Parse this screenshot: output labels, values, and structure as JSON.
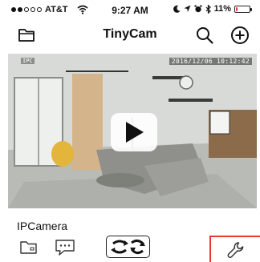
{
  "status_bar": {
    "signal_dots_filled": 2,
    "signal_dots_total": 5,
    "carrier": "AT&T",
    "time": "9:27 AM",
    "battery_percent": "11%",
    "battery_level": 0.11,
    "icons": [
      "wifi-icon",
      "moon-icon",
      "location-icon",
      "alarm-icon",
      "bluetooth-icon"
    ]
  },
  "nav": {
    "title": "TinyCam",
    "left_icon": "folder-icon",
    "right_icons": [
      "search-icon",
      "add-icon"
    ]
  },
  "camera": {
    "name": "IPCamera",
    "overlay_label": "IPC",
    "timestamp": "2016/12/06 10:12:42",
    "play_icon": "play-icon"
  },
  "toolbar": {
    "items": [
      "folder-icon",
      "message-icon",
      "ptz-icon",
      "settings-wrench-icon"
    ]
  },
  "colors": {
    "accent": "#e53935",
    "text": "#111111",
    "background": "#ffffff"
  }
}
